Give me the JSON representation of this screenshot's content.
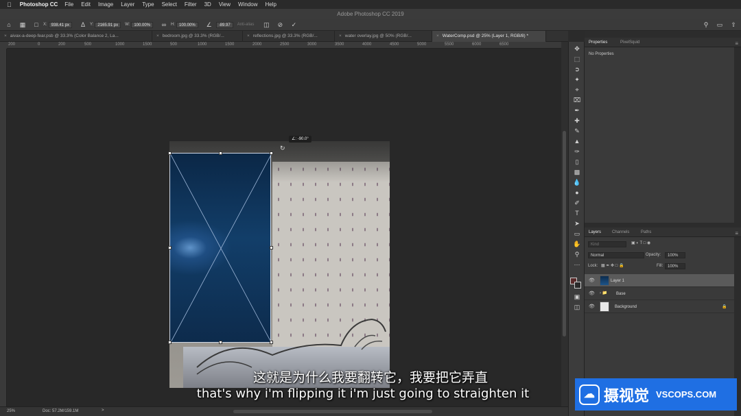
{
  "menubar": {
    "app_name": "Photoshop CC",
    "items": [
      "File",
      "Edit",
      "Image",
      "Layer",
      "Type",
      "Select",
      "Filter",
      "3D",
      "View",
      "Window",
      "Help"
    ]
  },
  "window": {
    "title": "Adobe Photoshop CC 2019"
  },
  "options_bar": {
    "x_label": "X:",
    "x_value": "938.41 px",
    "y_label": "Y:",
    "y_value": "2165.91 px",
    "w_label": "W:",
    "w_value": "100.00%",
    "h_label": "H:",
    "h_value": "100.00%",
    "angle_value": "-89.97",
    "interp_label": "Anti-alias"
  },
  "tabs": [
    {
      "label": "aivax-a-deep-fear.psb @ 33.3% (Color Balance 2, La...",
      "active": false
    },
    {
      "label": "bedroom.jpg @ 33.3% (RGB/...",
      "active": false
    },
    {
      "label": "reflections.jpg @ 33.3% (RGB/...",
      "active": false
    },
    {
      "label": "water overlay.jpg @ 50% (RGB/...",
      "active": false
    },
    {
      "label": "WaterComp.psd @ 25% (Layer 1, RGB/8) *",
      "active": true
    }
  ],
  "ruler_ticks": [
    "200",
    "0",
    "200",
    "500",
    "1000",
    "1500",
    "500",
    "1000",
    "1500",
    "2000",
    "2500",
    "3000",
    "3500",
    "4000",
    "4500",
    "5000",
    "5500",
    "6000",
    "6500"
  ],
  "canvas": {
    "angle_readout": "∠: -90.0°"
  },
  "status": {
    "zoom": "25%",
    "doc": "Doc: 57.2M/159.1M",
    "arrow": ">"
  },
  "properties_panel": {
    "tabs": [
      "Properties",
      "PixelSquid"
    ],
    "empty_text": "No Properties"
  },
  "layers_panel": {
    "tabs": [
      "Layers",
      "Channels",
      "Paths"
    ],
    "filter_placeholder": "Kind",
    "blend_mode": "Normal",
    "opacity_label": "Opacity:",
    "opacity_value": "100%",
    "lock_label": "Lock:",
    "fill_label": "Fill:",
    "fill_value": "100%",
    "layers": [
      {
        "name": "Layer 1",
        "selected": true
      },
      {
        "name": "Base",
        "selected": false
      },
      {
        "name": "Background",
        "selected": false
      }
    ]
  },
  "subtitles": {
    "chinese": "这就是为什么我要翻转它，我要把它弄直",
    "english": "that's why i'm flipping it i'm just going to straighten it"
  },
  "watermark": {
    "cn": "摄视觉",
    "en": "VSCOPS.COM"
  }
}
